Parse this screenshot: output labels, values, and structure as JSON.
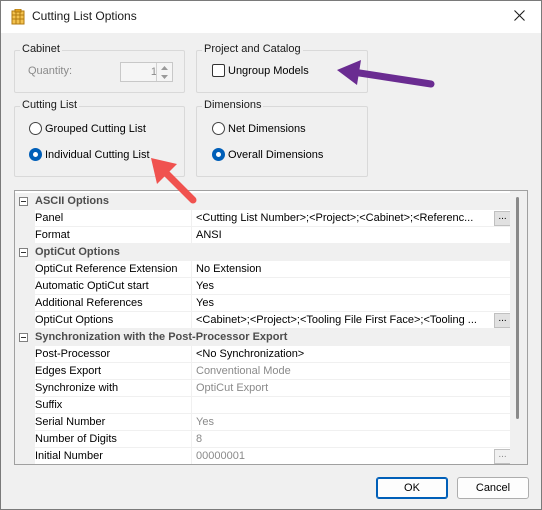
{
  "window": {
    "title": "Cutting List Options",
    "icon": "cutting-list-app-icon",
    "close_icon": "close-icon"
  },
  "cabinet": {
    "group_label": "Cabinet",
    "quantity_label": "Quantity:",
    "quantity_value": "1"
  },
  "project_catalog": {
    "group_label": "Project and Catalog",
    "ungroup_models_label": "Ungroup Models",
    "ungroup_models_checked": false
  },
  "cutting_list": {
    "group_label": "Cutting List",
    "options": [
      {
        "label": "Grouped Cutting List",
        "selected": false
      },
      {
        "label": "Individual Cutting List",
        "selected": true
      }
    ]
  },
  "dimensions": {
    "group_label": "Dimensions",
    "options": [
      {
        "label": "Net Dimensions",
        "selected": false
      },
      {
        "label": "Overall Dimensions",
        "selected": true
      }
    ]
  },
  "grid": {
    "categories": [
      {
        "label": "ASCII Options",
        "rows": [
          {
            "name": "Panel",
            "value": "<Cutting List Number>;<Project>;<Cabinet>;<Referenc...",
            "ellipsis": true,
            "disabled": false
          },
          {
            "name": "Format",
            "value": "ANSI",
            "ellipsis": false,
            "disabled": false
          }
        ]
      },
      {
        "label": "OptiCut Options",
        "rows": [
          {
            "name": "OptiCut Reference Extension",
            "value": "No Extension",
            "ellipsis": false,
            "disabled": false
          },
          {
            "name": "Automatic OptiCut start",
            "value": "Yes",
            "ellipsis": false,
            "disabled": false
          },
          {
            "name": "Additional References",
            "value": "Yes",
            "ellipsis": false,
            "disabled": false
          },
          {
            "name": "OptiCut Options",
            "value": "<Cabinet>;<Project>;<Tooling File First Face>;<Tooling ...",
            "ellipsis": true,
            "disabled": false
          }
        ]
      },
      {
        "label": "Synchronization with the Post-Processor Export",
        "rows": [
          {
            "name": "Post-Processor",
            "value": "<No Synchronization>",
            "ellipsis": false,
            "disabled": false
          },
          {
            "name": "Edges Export",
            "value": "Conventional Mode",
            "ellipsis": false,
            "disabled": true
          },
          {
            "name": "Synchronize with",
            "value": "OptiCut Export",
            "ellipsis": false,
            "disabled": true
          },
          {
            "name": "Suffix",
            "value": "",
            "ellipsis": false,
            "disabled": true
          },
          {
            "name": "Serial Number",
            "value": "Yes",
            "ellipsis": false,
            "disabled": true
          },
          {
            "name": "Number of Digits",
            "value": "8",
            "ellipsis": false,
            "disabled": true
          },
          {
            "name": "Initial Number",
            "value": "00000001",
            "ellipsis": true,
            "disabled": true
          }
        ]
      }
    ]
  },
  "buttons": {
    "ok": "OK",
    "cancel": "Cancel"
  },
  "colors": {
    "accent": "#005fb8",
    "annotation_purple": "#6a2c91",
    "annotation_red": "#f0524f"
  }
}
